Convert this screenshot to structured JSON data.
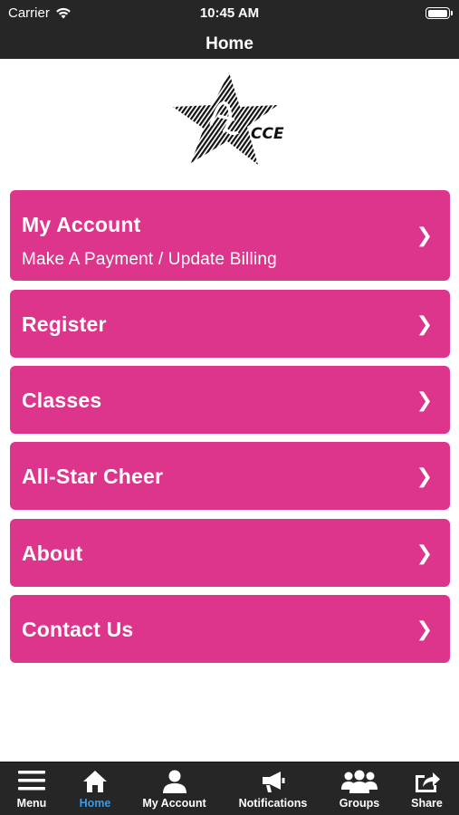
{
  "status_bar": {
    "carrier": "Carrier",
    "time": "10:45 AM",
    "battery_level": 1.0
  },
  "nav": {
    "title": "Home"
  },
  "logo": {
    "text": "CCE"
  },
  "menu_items": [
    {
      "title": "My Account",
      "subtitle": "Make A Payment / Update Billing"
    },
    {
      "title": "Register"
    },
    {
      "title": "Classes"
    },
    {
      "title": "All-Star Cheer"
    },
    {
      "title": "About"
    },
    {
      "title": "Contact Us"
    }
  ],
  "chevron": "❯",
  "tab_bar": {
    "items": [
      {
        "label": "Menu",
        "icon": "hamburger-icon",
        "active": false
      },
      {
        "label": "Home",
        "icon": "home-icon",
        "active": true
      },
      {
        "label": "My Account",
        "icon": "person-icon",
        "active": false
      },
      {
        "label": "Notifications",
        "icon": "megaphone-icon",
        "active": false
      },
      {
        "label": "Groups",
        "icon": "group-icon",
        "active": false
      },
      {
        "label": "Share",
        "icon": "share-icon",
        "active": false
      }
    ]
  },
  "colors": {
    "accent": "#dd358b",
    "bar": "#262626",
    "active_tab": "#3a9ae8"
  }
}
